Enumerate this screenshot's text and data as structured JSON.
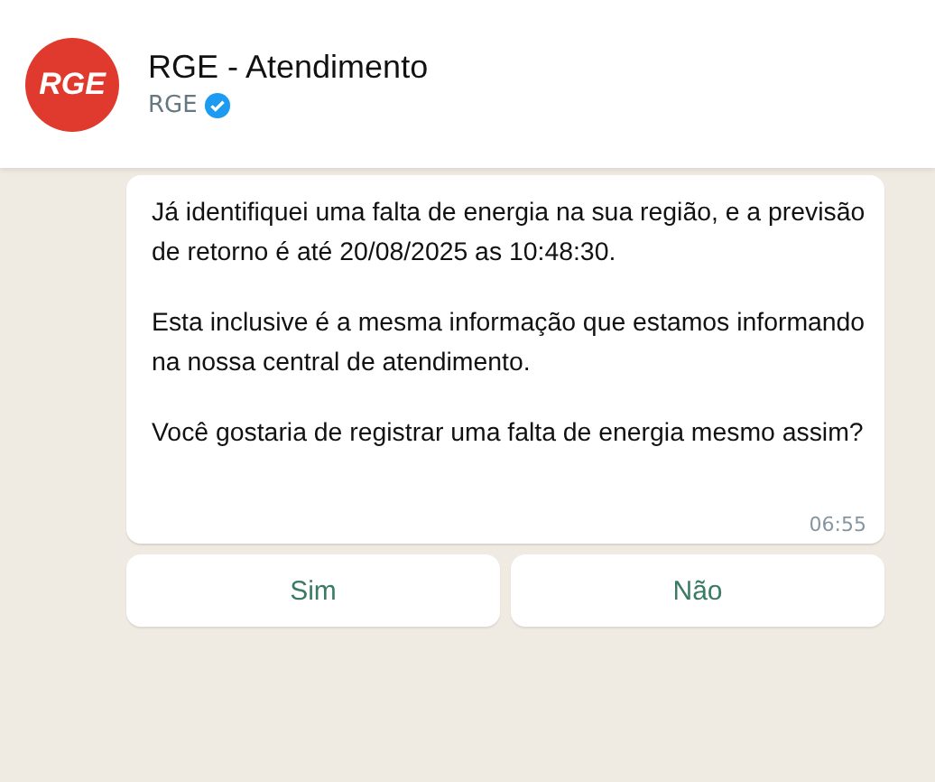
{
  "header": {
    "logo_text": "RGE",
    "title": "RGE - Atendimento",
    "subtitle": "RGE",
    "verified": true
  },
  "message": {
    "paragraphs": [
      "Já identifiquei uma falta de energia na sua região, e a previsão de retorno é até 20/08/2025 as 10:48:30.",
      "Esta inclusive é a mesma informação que estamos informando na nossa central de atendimento.",
      "Você gostaria de registrar uma falta de energia mesmo assim?"
    ],
    "time": "06:55"
  },
  "buttons": [
    "Sim",
    "Não"
  ]
}
